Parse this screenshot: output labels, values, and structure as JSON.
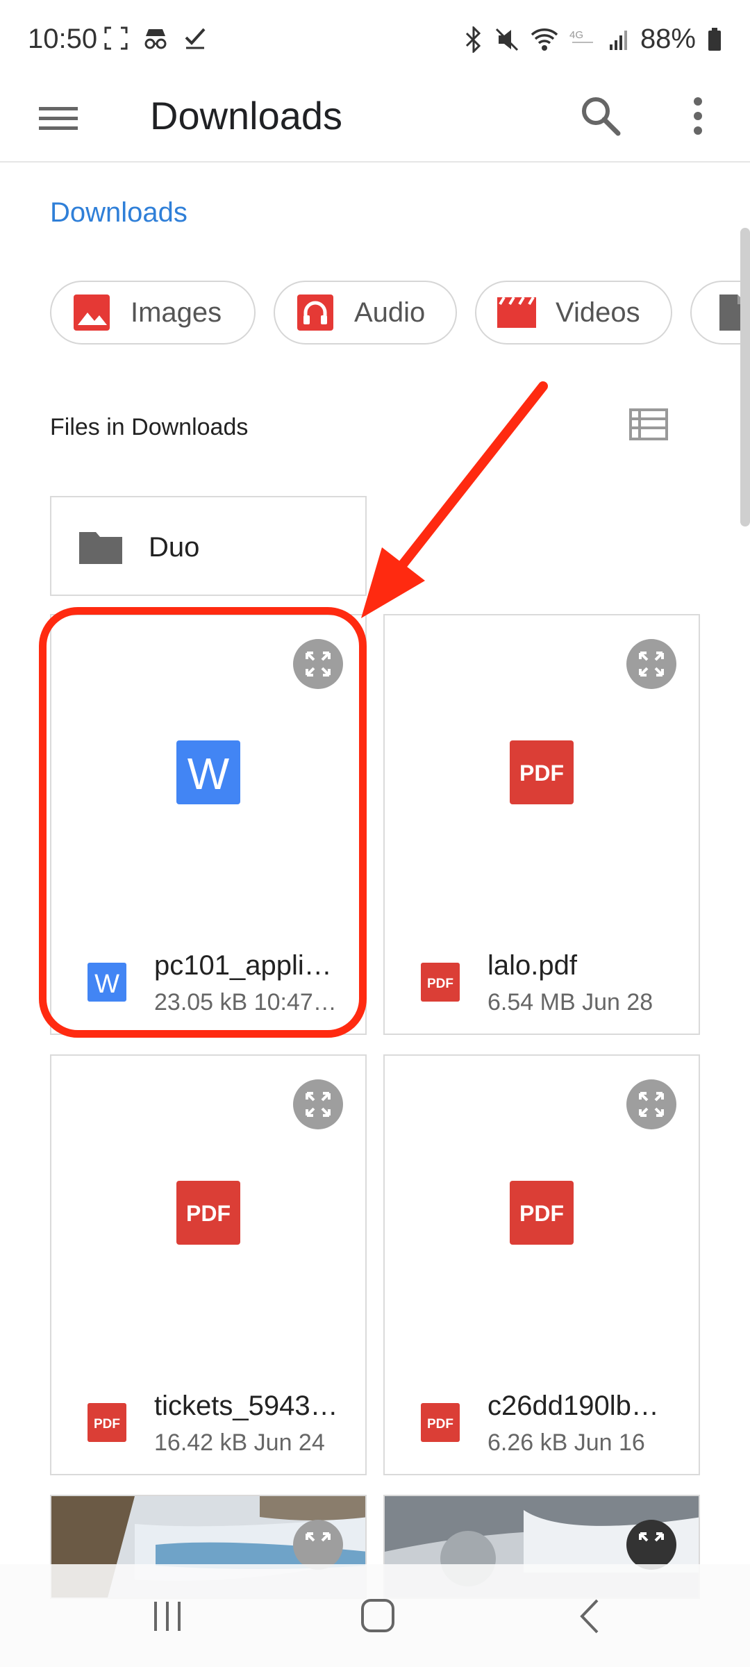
{
  "status_bar": {
    "time": "10:50",
    "battery": "88%",
    "left_icons": [
      "screenshot-icon",
      "incognito-icon",
      "check-icon"
    ],
    "right_icons": [
      "bluetooth-icon",
      "mute-icon",
      "wifi-icon",
      "lte-icon",
      "signal-icon",
      "battery-icon"
    ]
  },
  "app_bar": {
    "title": "Downloads"
  },
  "breadcrumb": "Downloads",
  "chips": [
    {
      "label": "Images",
      "icon": "image-icon",
      "color": "#e53935"
    },
    {
      "label": "Audio",
      "icon": "headphones-icon",
      "color": "#e53935"
    },
    {
      "label": "Videos",
      "icon": "clapperboard-icon",
      "color": "#e53935"
    },
    {
      "label": "",
      "icon": "document-icon",
      "color": "#666666"
    }
  ],
  "section": {
    "title": "Files in Downloads",
    "view_icon": "list-view-icon"
  },
  "folder": {
    "name": "Duo",
    "icon": "folder-icon"
  },
  "files": [
    {
      "name": "pc101_appli…",
      "meta": "23.05 kB 10:47…",
      "type": "W",
      "icon_color": "#4285f4"
    },
    {
      "name": "lalo.pdf",
      "meta": "6.54 MB Jun 28",
      "type": "PDF",
      "icon_color": "#db3e36"
    },
    {
      "name": "tickets_5943…",
      "meta": "16.42 kB Jun 24",
      "type": "PDF",
      "icon_color": "#db3e36"
    },
    {
      "name": "c26dd190lb…",
      "meta": "6.26 kB Jun 16",
      "type": "PDF",
      "icon_color": "#db3e36"
    }
  ],
  "colors": {
    "accent": "#2f7fd8",
    "highlight": "#ff2a10"
  }
}
